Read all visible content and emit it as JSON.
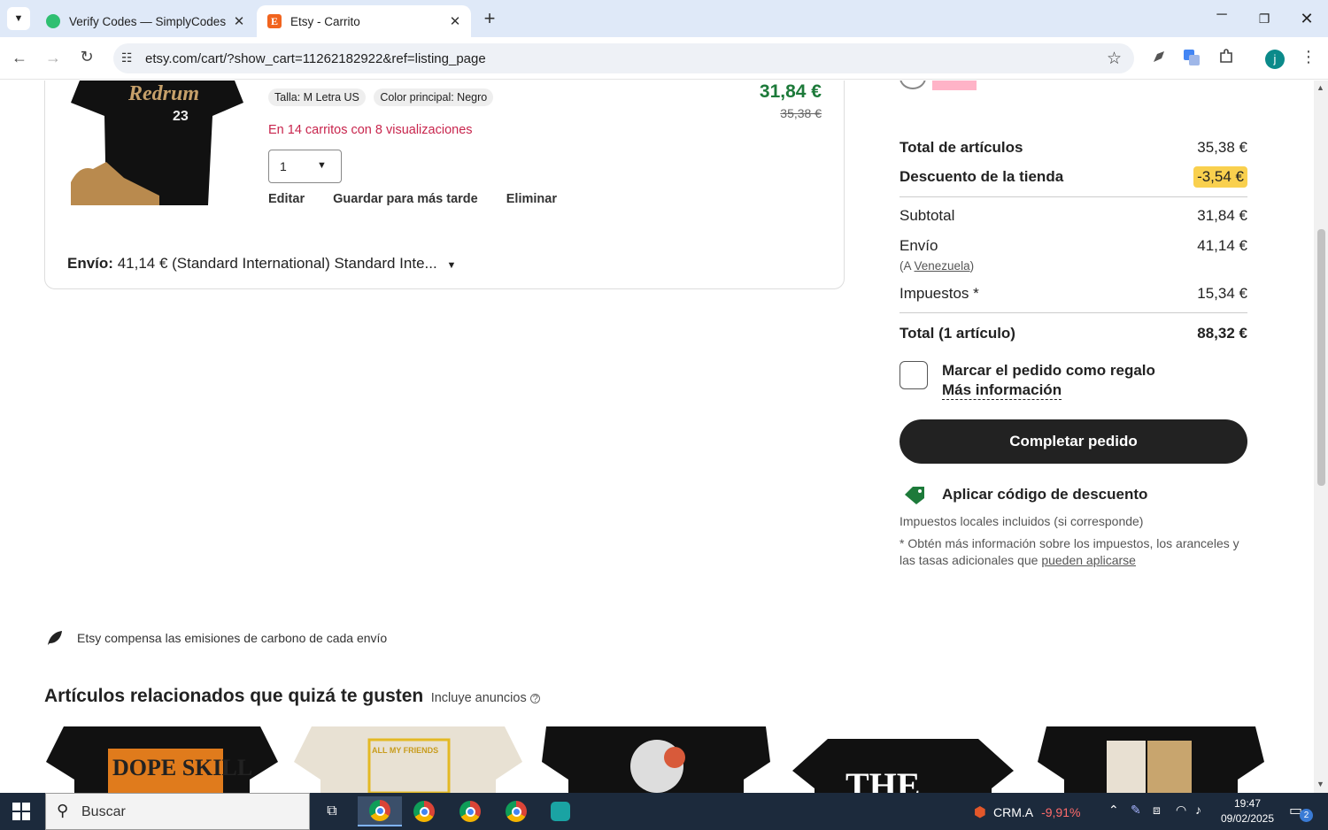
{
  "browser": {
    "tabs": [
      {
        "title": "Verify Codes — SimplyCodes",
        "close": "✕"
      },
      {
        "title": "Etsy - Carrito",
        "close": "✕"
      }
    ],
    "url": "etsy.com/cart/?show_cart=11262182922&ref=listing_page",
    "profile_initial": "j"
  },
  "item": {
    "chips": [
      "Talla: M Letra US",
      "Color principal: Negro"
    ],
    "carts_notice": "En 14 carritos con 8 visualizaciones",
    "quantity": "1",
    "actions": [
      "Editar",
      "Guardar para más tarde",
      "Eliminar"
    ],
    "price": "31,84 €",
    "old_price": "35,38 €",
    "shirt_text": "Redrum",
    "shirt_number": "23",
    "shipping_label": "Envío:",
    "shipping_value": "41,14 € (Standard International) Standard Inte..."
  },
  "summary": {
    "items_total_label": "Total de artículos",
    "items_total_value": "35,38 €",
    "discount_label": "Descuento de la tienda",
    "discount_value": "-3,54 €",
    "subtotal_label": "Subtotal",
    "subtotal_value": "31,84 €",
    "shipping_label": "Envío",
    "shipping_value": "41,14 €",
    "shipping_to_prefix": "(A ",
    "shipping_to_country": "Venezuela",
    "shipping_to_suffix": ")",
    "taxes_label": "Impuestos *",
    "taxes_value": "15,34 €",
    "total_label": "Total (1 artículo)",
    "total_value": "88,32 €",
    "gift_label": "Marcar el pedido como regalo",
    "gift_more": "Más información",
    "checkout_button": "Completar pedido",
    "coupon_label": "Aplicar código de descuento",
    "tax_note_1": "Impuestos locales incluidos (si corresponde)",
    "tax_note_2": "* Obtén más información sobre los impuestos, los aranceles y las tasas adicionales que ",
    "tax_note_link": "pueden aplicarse"
  },
  "carbon_note": "Etsy compensa las emisiones de carbono de cada envío",
  "related": {
    "title": "Artículos relacionados que quizá te gusten",
    "ads_note": "Incluye anuncios",
    "product_texts": [
      "DOPE SKILL",
      "ALL MY FRIENDS",
      "",
      "THE",
      ""
    ]
  },
  "taskbar": {
    "search_placeholder": "Buscar",
    "stock_symbol": "CRM.A",
    "stock_change": "-9,91%",
    "time": "19:47",
    "date": "09/02/2025",
    "notifications": "2"
  },
  "colors": {
    "price_green": "#1d7a3a",
    "notice_red": "#c8254d",
    "discount_bg": "#f9d04e",
    "button_dark": "#222222",
    "taskbar": "#1c2a3c"
  }
}
